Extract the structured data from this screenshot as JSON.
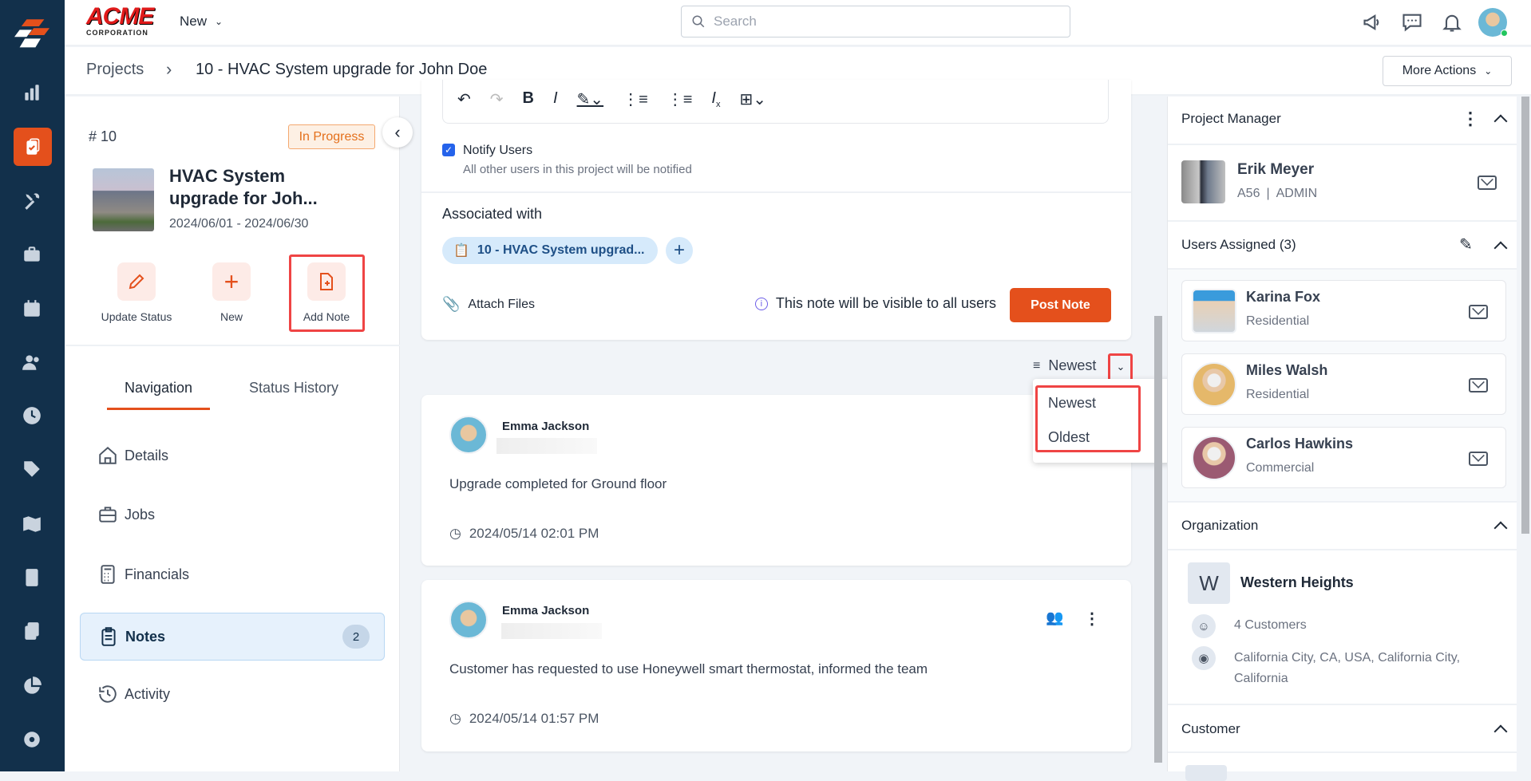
{
  "topbar": {
    "logo_text": "ACME",
    "logo_sub": "CORPORATION",
    "new_label": "New",
    "search_placeholder": "Search"
  },
  "breadcrumb": {
    "root": "Projects",
    "current": "10 - HVAC System upgrade for John Doe",
    "more_actions": "More Actions"
  },
  "project": {
    "number": "# 10",
    "status": "In Progress",
    "title": "HVAC System upgrade for Joh...",
    "dates": "2024/06/01 - 2024/06/30",
    "actions": [
      {
        "label": "Update Status"
      },
      {
        "label": "New"
      },
      {
        "label": "Add Note"
      }
    ]
  },
  "tabs": [
    {
      "label": "Navigation"
    },
    {
      "label": "Status History"
    }
  ],
  "nav": [
    {
      "label": "Details"
    },
    {
      "label": "Jobs"
    },
    {
      "label": "Financials"
    },
    {
      "label": "Notes",
      "badge": "2"
    },
    {
      "label": "Activity"
    }
  ],
  "composer": {
    "notify_label": "Notify Users",
    "notify_sub": "All other users in this project will be notified",
    "associated_label": "Associated with",
    "chip": "10 - HVAC System upgrad...",
    "attach": "Attach Files",
    "visibility": "This note will be visible to all users",
    "post": "Post Note"
  },
  "sort": {
    "current": "Newest",
    "options": [
      "Newest",
      "Oldest"
    ]
  },
  "notes": [
    {
      "author": "Emma Jackson",
      "text": "Upgrade completed for Ground floor",
      "time": "2024/05/14 02:01 PM"
    },
    {
      "author": "Emma Jackson",
      "text": "Customer has requested to use Honeywell smart thermostat, informed the team",
      "time": "2024/05/14 01:57 PM"
    }
  ],
  "right": {
    "pm_title": "Project Manager",
    "pm_name": "Erik Meyer",
    "pm_code": "A56",
    "pm_role": "ADMIN",
    "users_title": "Users Assigned (3)",
    "users": [
      {
        "name": "Karina Fox",
        "type": "Residential"
      },
      {
        "name": "Miles Walsh",
        "type": "Residential"
      },
      {
        "name": "Carlos Hawkins",
        "type": "Commercial"
      }
    ],
    "org_title": "Organization",
    "org_initial": "W",
    "org_name": "Western Heights",
    "org_customers": "4 Customers",
    "org_address": "California City, CA, USA, California City, California",
    "customer_title": "Customer"
  },
  "colors": {
    "accent": "#e4501c",
    "sidebar": "#12304b",
    "highlight": "#ef4444"
  }
}
